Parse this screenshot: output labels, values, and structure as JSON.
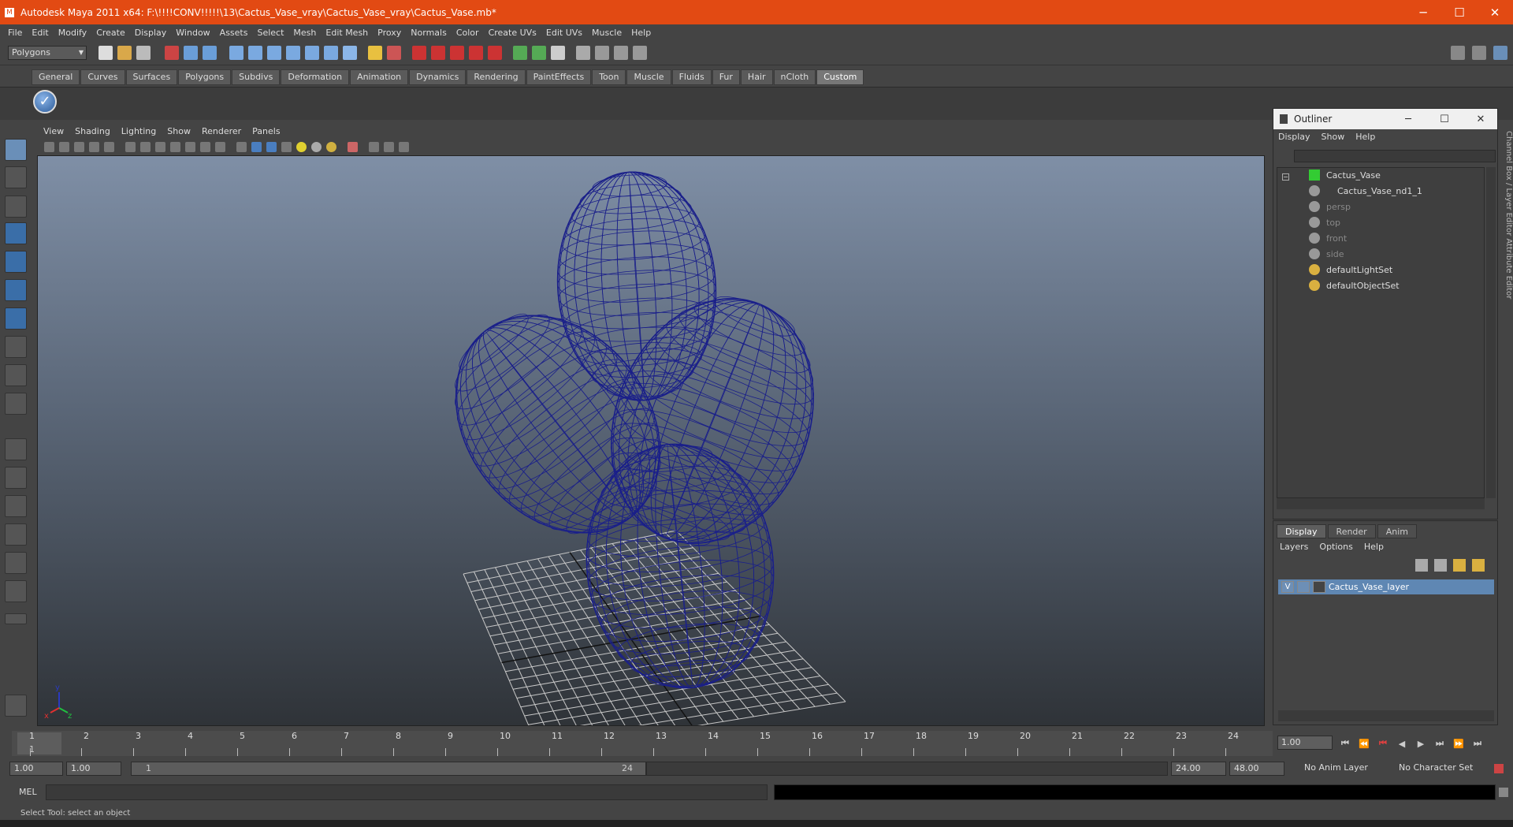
{
  "window": {
    "title": "Autodesk Maya 2011 x64: F:\\!!!!CONV!!!!!\\13\\Cactus_Vase_vray\\Cactus_Vase_vray\\Cactus_Vase.mb*",
    "minimize": "─",
    "maximize": "☐",
    "close": "✕"
  },
  "menubar": [
    "File",
    "Edit",
    "Modify",
    "Create",
    "Display",
    "Window",
    "Assets",
    "Select",
    "Mesh",
    "Edit Mesh",
    "Proxy",
    "Normals",
    "Color",
    "Create UVs",
    "Edit UVs",
    "Muscle",
    "Help"
  ],
  "toolbar": {
    "mode": "Polygons"
  },
  "shelf": {
    "tabs": [
      "General",
      "Curves",
      "Surfaces",
      "Polygons",
      "Subdivs",
      "Deformation",
      "Animation",
      "Dynamics",
      "Rendering",
      "PaintEffects",
      "Toon",
      "Muscle",
      "Fluids",
      "Fur",
      "Hair",
      "nCloth",
      "Custom"
    ],
    "active": "Custom",
    "button_icon": "✓"
  },
  "viewport": {
    "menu": [
      "View",
      "Shading",
      "Lighting",
      "Show",
      "Renderer",
      "Panels"
    ],
    "axis": {
      "x": "x",
      "y": "y",
      "z": "z"
    }
  },
  "outliner": {
    "title": "Outliner",
    "menu": [
      "Display",
      "Show",
      "Help"
    ],
    "items": [
      {
        "label": "Cactus_Vase",
        "dim": false
      },
      {
        "label": "Cactus_Vase_nd1_1",
        "dim": false
      },
      {
        "label": "persp",
        "dim": true
      },
      {
        "label": "top",
        "dim": true
      },
      {
        "label": "front",
        "dim": true
      },
      {
        "label": "side",
        "dim": true
      },
      {
        "label": "defaultLightSet",
        "dim": false
      },
      {
        "label": "defaultObjectSet",
        "dim": false
      }
    ]
  },
  "sidetabs": "Channel Box / Layer Editor    Attribute Editor",
  "layers": {
    "tabs": [
      "Display",
      "Render",
      "Anim"
    ],
    "active": "Display",
    "menu": [
      "Layers",
      "Options",
      "Help"
    ],
    "layer": {
      "visible": "V",
      "name": "Cactus_Vase_layer"
    }
  },
  "timeline": {
    "ticks": [
      "1",
      "2",
      "3",
      "4",
      "5",
      "6",
      "7",
      "8",
      "9",
      "10",
      "11",
      "12",
      "13",
      "14",
      "15",
      "16",
      "17",
      "18",
      "19",
      "20",
      "21",
      "22",
      "23",
      "24"
    ],
    "current": "1",
    "current_field": "1.00"
  },
  "playback": [
    "⏮",
    "⏪",
    "⏮",
    "◀",
    "▶",
    "⏭",
    "⏩",
    "⏭"
  ],
  "range": {
    "start": "1.00",
    "playback_start": "1.00",
    "slider_start": "1",
    "slider_end": "24",
    "playback_end": "24.00",
    "end": "48.00",
    "anim_layer": "No Anim Layer",
    "char_set": "No Character Set"
  },
  "cmdline": {
    "label": "MEL"
  },
  "status": "Select Tool: select an object"
}
